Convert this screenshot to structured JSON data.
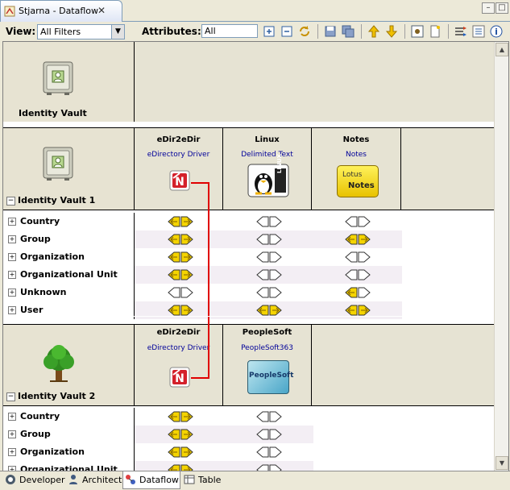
{
  "window": {
    "title": "Stjarna - Dataflow"
  },
  "toolbar": {
    "view_label": "View:",
    "view_value": "All Filters",
    "attributes_label": "Attributes:",
    "attributes_value": "All"
  },
  "vaults": [
    {
      "name": "Identity Vault"
    },
    {
      "name": "Identity Vault 1",
      "drivers": [
        {
          "name": "eDir2eDir",
          "type": "eDirectory Driver",
          "icon": "novell-icon"
        },
        {
          "name": "Linux",
          "type": "Delimited Text",
          "icon": "linux-icon",
          "badge": "LINUX"
        },
        {
          "name": "Notes",
          "type": "Notes",
          "icon": "lotus-notes-icon",
          "badge_line1": "Lotus",
          "badge_line2": "Notes"
        }
      ],
      "classes": [
        "Country",
        "Group",
        "Organization",
        "Organizational Unit",
        "Unknown",
        "User"
      ]
    },
    {
      "name": "Identity Vault 2",
      "drivers": [
        {
          "name": "eDir2eDir",
          "type": "eDirectory Driver",
          "icon": "novell-icon"
        },
        {
          "name": "PeopleSoft",
          "type": "PeopleSoft363",
          "icon": "peoplesoft-icon",
          "badge": "PeopleSoft"
        }
      ],
      "classes": [
        "Country",
        "Group",
        "Organization",
        "Organizational Unit"
      ]
    }
  ],
  "flows_vault1": [
    [
      "both",
      "none",
      "none"
    ],
    [
      "both",
      "none",
      "both"
    ],
    [
      "both",
      "none",
      "none"
    ],
    [
      "both",
      "none",
      "none"
    ],
    [
      "none",
      "none",
      "left"
    ],
    [
      "both",
      "both",
      "both"
    ]
  ],
  "flows_vault2": [
    [
      "both",
      "none"
    ],
    [
      "both",
      "none"
    ],
    [
      "both",
      "none"
    ],
    [
      "both",
      "none"
    ]
  ],
  "bottom_tabs": [
    {
      "label": "Developer",
      "icon": "developer-icon"
    },
    {
      "label": "Architect",
      "icon": "architect-icon"
    },
    {
      "label": "Dataflow",
      "icon": "dataflow-icon",
      "active": true
    },
    {
      "label": "Table",
      "icon": "table-icon"
    }
  ],
  "colors": {
    "arrow_fill": "#f5d400",
    "connector": "#e00000",
    "vault_bg": "#e7e3d2",
    "stripe": "#f3eef4"
  }
}
